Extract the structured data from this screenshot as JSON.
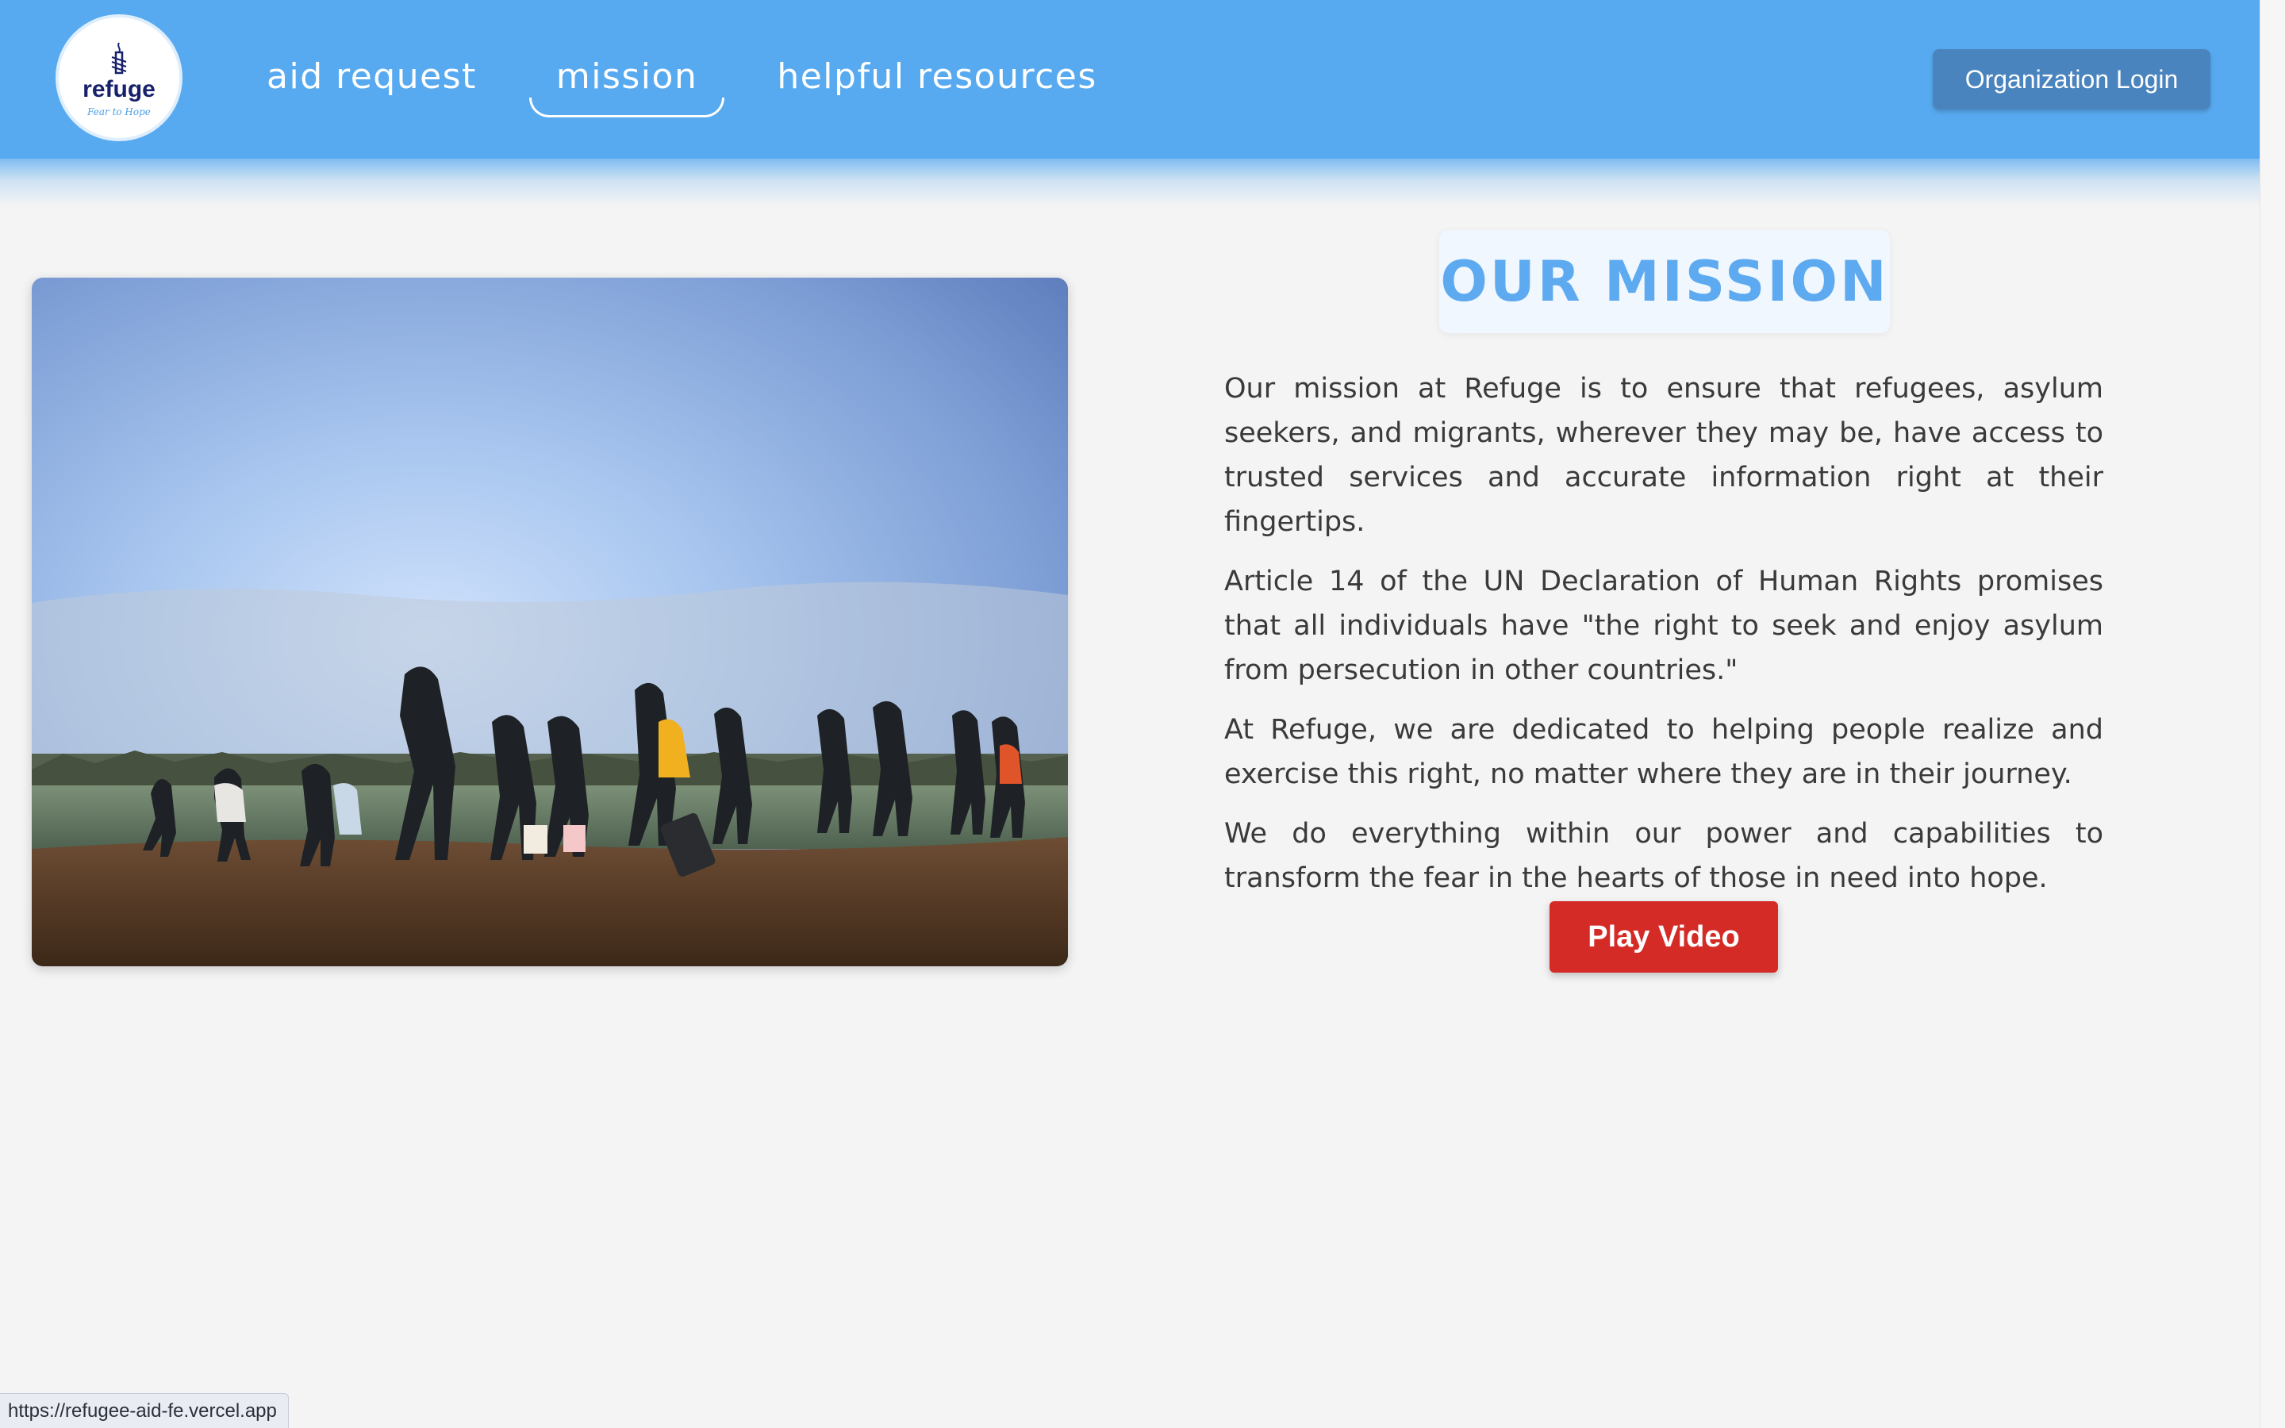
{
  "header": {
    "logo": {
      "name": "refuge",
      "tagline": "Fear to Hope",
      "emblem_icon": "candle-barbed-wire-icon"
    },
    "nav": [
      {
        "label": "aid request",
        "active": false
      },
      {
        "label": "mission",
        "active": true
      },
      {
        "label": "helpful resources",
        "active": false
      }
    ],
    "login_label": "Organization Login",
    "colors": {
      "bar": "#58aaf0",
      "login": "#4a84be"
    }
  },
  "main": {
    "photo_alt": "Group of refugees walking along a dirt road across a field",
    "mission_title": "OUR MISSION",
    "paragraphs": [
      "Our mission at Refuge is to ensure that refugees, asylum seekers, and migrants, wherever they may be, have access to trusted services and accurate information right at their fingertips.",
      "Article 14 of the UN Declaration of Human Rights promises that all individuals have \"the right to seek and enjoy asylum from persecution in other countries.\"",
      "At Refuge, we are dedicated to helping people realize and exercise this right, no matter where they are in their journey.",
      "We do everything within our power and capabilities to transform the fear in the hearts of those in need into hope."
    ],
    "play_label": "Play Video",
    "colors": {
      "title": "#5eaaf0",
      "play": "#d42b27"
    }
  },
  "status_bar": {
    "url": "https://refugee-aid-fe.vercel.app"
  }
}
